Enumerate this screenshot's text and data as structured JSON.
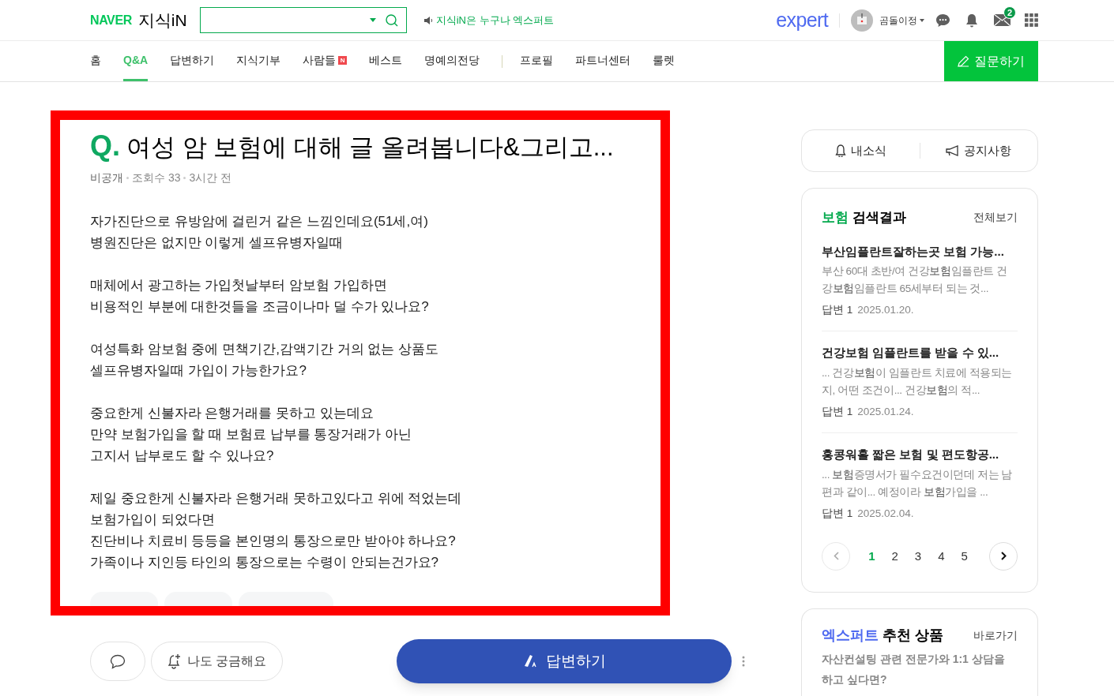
{
  "header": {
    "logo_brand": "NAVER",
    "logo_service": "지식iN",
    "notice": "지식iN은 누구나 엑스퍼트",
    "expert_logo": "expert",
    "user_name": "곰돌이정",
    "mail_badge": "2"
  },
  "nav": {
    "items": [
      {
        "label": "홈",
        "selected": false
      },
      {
        "label": "Q&A",
        "selected": true
      },
      {
        "label": "답변하기",
        "selected": false
      },
      {
        "label": "지식기부",
        "selected": false
      },
      {
        "label": "사람들",
        "selected": false,
        "badge": "N"
      },
      {
        "label": "베스트",
        "selected": false
      },
      {
        "label": "명예의전당",
        "selected": false
      },
      {
        "label": "프로필",
        "selected": false
      },
      {
        "label": "파트너센터",
        "selected": false
      },
      {
        "label": "룰렛",
        "selected": false
      }
    ],
    "ask_button": "질문하기"
  },
  "question": {
    "mark": "Q.",
    "title": "여성 암 보험에 대해 글 올려봅니다&그리고...",
    "meta": [
      "비공개",
      "조회수 33",
      "3시간 전"
    ],
    "paragraphs": [
      [
        "자가진단으로 유방암에 걸린거 같은 느낌인데요(51세,여)",
        "병원진단은 없지만 이렇게 셀프유병자일때"
      ],
      [
        "매체에서 광고하는 가입첫날부터 암보험 가입하면",
        "비용적인 부분에 대한것들을 조금이나마 덜 수가 있나요?"
      ],
      [
        "여성특화 암보험 중에 면책기간,감액기간 거의 없는 상품도",
        "셀프유병자일때 가입이 가능한가요?"
      ],
      [
        "중요한게 신불자라 은행거래를 못하고 있는데요",
        "만약 보험가입을 할 때 보험료 납부를 통장거래가 아닌",
        "고지서 납부로도 할 수 있나요?"
      ],
      [
        "제일 중요한게 신불자라 은행거래 못하고있다고 위에 적었는데",
        "보험가입이 되었다면",
        "진단비나 치료비 등등을 본인명의 통장으로만 받아야 하나요?",
        "가족이나 지인등 타인의 통장으로는 수령이 안되는건가요?"
      ]
    ],
    "curious_button": "나도 궁금해요",
    "answer_button": "답변하기"
  },
  "sidebar": {
    "my_news": "내소식",
    "notices": "공지사항",
    "search_results": {
      "keyword": "보험",
      "title": "검색결과",
      "more": "전체보기",
      "items": [
        {
          "title": "부산임플란트잘하는곳 보험 가능...",
          "snippet": "부산 60대 초반/여 건강**보험**임플란트 건강**보험**임플란트 65세부터 되는 것...",
          "answers": "답변 1",
          "date": "2025.01.20."
        },
        {
          "title": "건강보험 임플란트를 받을 수 있...",
          "snippet": "... 건강**보험**이 임플란트 치료에 적용되는지, 어떤 조건이... 건강**보험**의 적...",
          "answers": "답변 1",
          "date": "2025.01.24."
        },
        {
          "title": "홍콩워홀 짧은 보험 및 편도항공...",
          "snippet": "... **보험**증명서가 필수요건이던데 저는 남편과 같이... 예정이라 **보험**가입을 ...",
          "answers": "답변 1",
          "date": "2025.02.04."
        }
      ],
      "pages": [
        {
          "label": "1",
          "selected": true
        },
        {
          "label": "2",
          "selected": false
        },
        {
          "label": "3",
          "selected": false
        },
        {
          "label": "4",
          "selected": false
        },
        {
          "label": "5",
          "selected": false
        }
      ]
    },
    "expert": {
      "brand": "엑스퍼트",
      "title": "추천 상품",
      "more": "바로가기",
      "text": "자산컨설팅 관련 전문가와 1:1 상담을 하고 싶다면?"
    }
  }
}
